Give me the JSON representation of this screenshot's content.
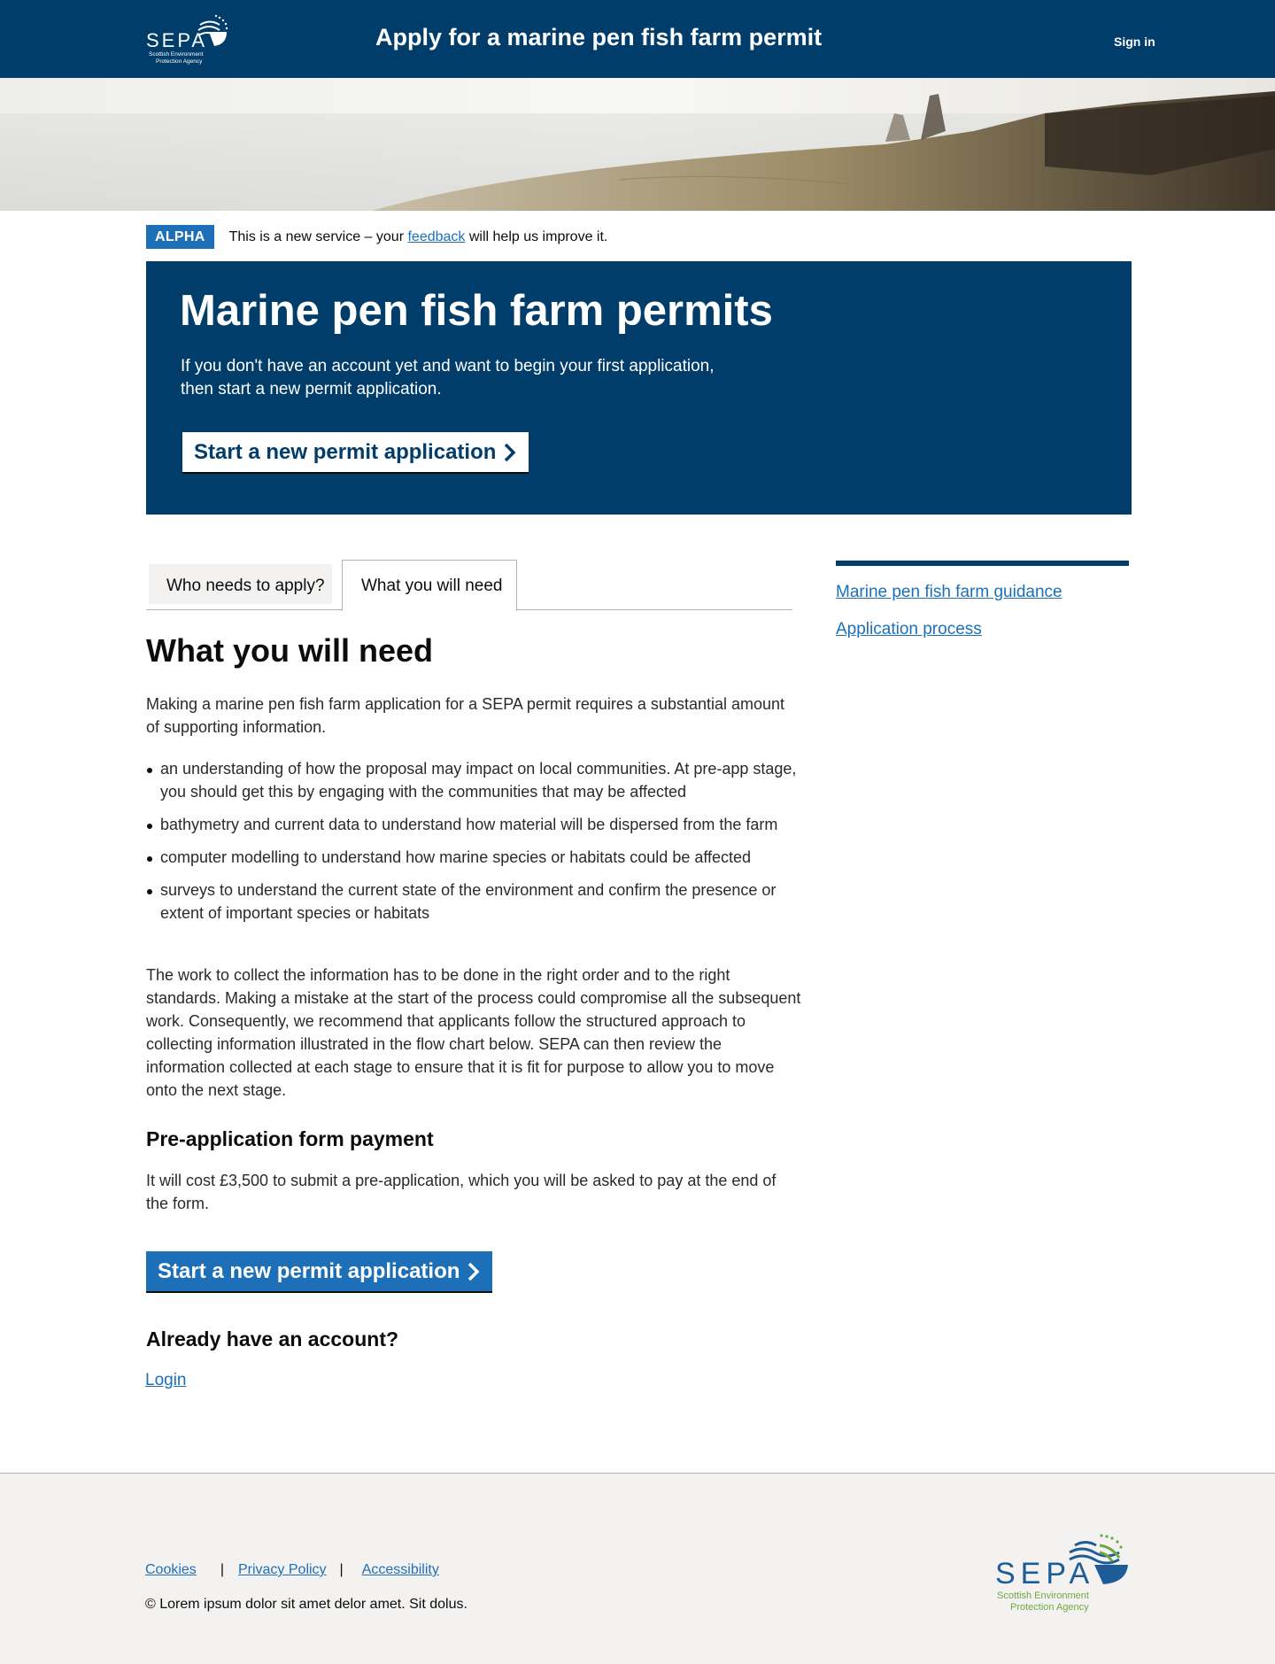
{
  "header": {
    "title": "Apply for a marine pen fish farm permit",
    "sign_in": "Sign in",
    "logo": {
      "wordmark": "SEPA",
      "line1": "Scottish Environment",
      "line2": "Protection Agency"
    }
  },
  "phase_banner": {
    "tag": "ALPHA",
    "text_before": "This is a new service – your ",
    "link": "feedback",
    "text_after": " will help us improve it."
  },
  "panel": {
    "title": "Marine pen fish farm permits",
    "text": "If you don't have an account yet and want to begin your first application, then start a new permit application.",
    "button": "Start a new permit application"
  },
  "tabs": [
    {
      "label": "Who needs to apply?"
    },
    {
      "label": "What you will need"
    }
  ],
  "main": {
    "heading": "What you will need",
    "intro": "Making a marine pen fish farm application for a SEPA permit requires a substantial amount of supporting information.",
    "bullets": [
      "an understanding of how the proposal may impact on local communities. At pre-app stage, you should get this by engaging with the communities that may be affected",
      "bathymetry and current data to understand how material will be dispersed from the farm",
      "computer modelling to understand how marine species or habitats could be affected",
      "surveys to understand the current state of the environment and confirm the presence or extent of important species or habitats"
    ],
    "paragraph": "The work to collect the information has to be done in the right order and to the right standards. Making a mistake at the start of the process could compromise all the subsequent work. Consequently, we recommend that applicants follow the structured approach to collecting information illustrated in the flow chart below. SEPA can then review the information collected at each stage to ensure that it is fit for purpose to allow you to move onto the next stage.",
    "payment_heading": "Pre-application form payment",
    "payment_text": "It will cost £3,500 to submit a pre-application, which you will be asked to pay at the end of the form.",
    "button": "Start a new permit application",
    "account_heading": "Already have an account?",
    "login": "Login"
  },
  "sidebar": {
    "links": [
      "Marine pen fish farm guidance",
      "Application process"
    ]
  },
  "footer": {
    "links": [
      "Cookies",
      "Privacy Policy",
      "Accessibility"
    ],
    "separator": "|",
    "copyright": "© Lorem ipsum dolor sit amet delor amet. Sit dolus.",
    "logo": {
      "wordmark": "SEPA",
      "line1": "Scottish Environment",
      "line2": "Protection Agency"
    }
  },
  "colors": {
    "navy": "#003d6a",
    "link_blue": "#1d70b8",
    "footer_bg": "#f3f2f1",
    "logo_green": "#6ea842"
  },
  "icons": {
    "button_chevron": "chevron-right-icon"
  }
}
